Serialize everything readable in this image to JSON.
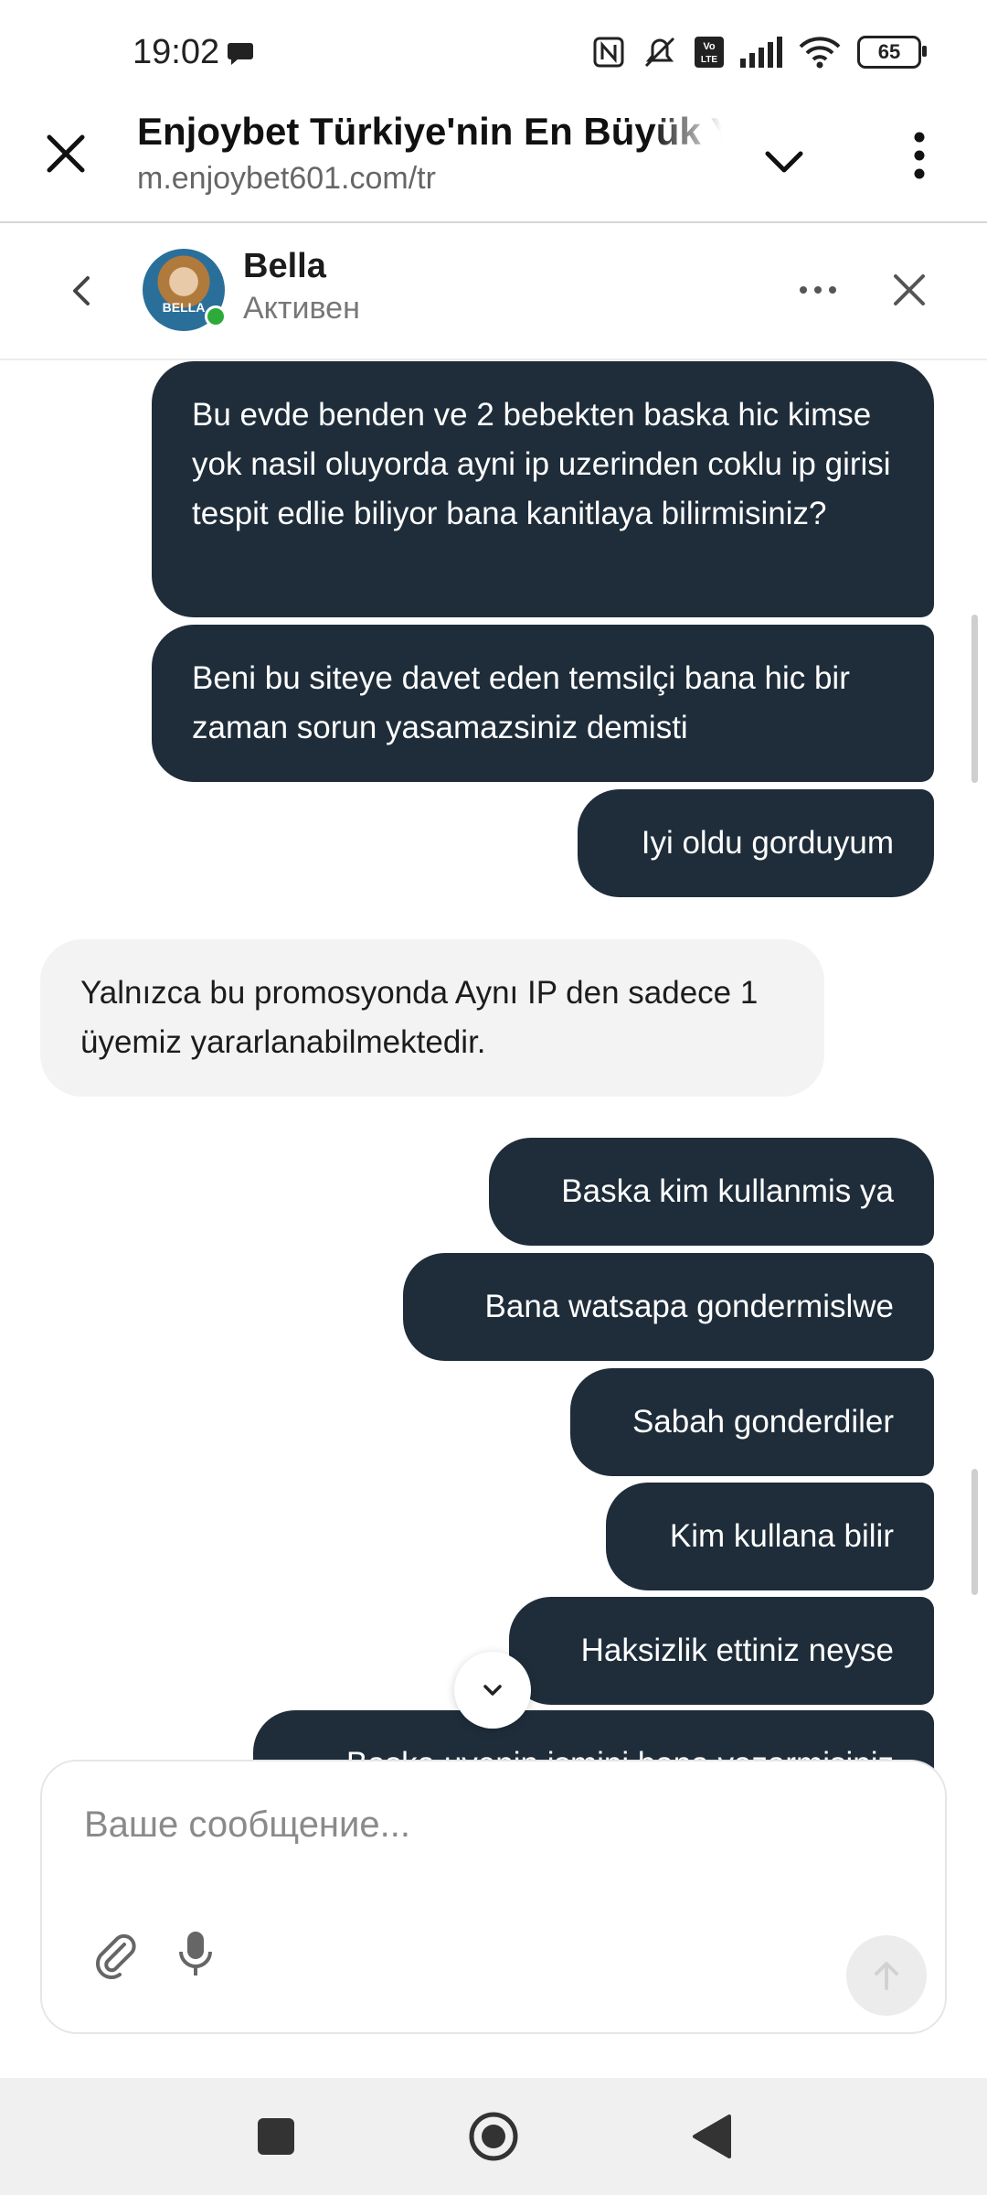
{
  "status_bar": {
    "time": "19:02",
    "battery": "65",
    "icons": [
      "message-icon",
      "nfc-icon",
      "mute-icon",
      "volte-icon",
      "signal-icon",
      "wifi-icon",
      "battery-icon"
    ]
  },
  "browser": {
    "title": "Enjoybet Türkiye'nin En Büyük Ya",
    "url": "m.enjoybet601.com/tr"
  },
  "chat": {
    "agent_name": "Bella",
    "agent_status": "Активен",
    "avatar_label": "BELLA"
  },
  "messages": [
    {
      "side": "out",
      "text": "Bu evde benden ve 2 bebekten baska hic kimse yok nasil oluyorda ayni ip uzerinden coklu ip girisi tespit edlie biliyor bana kanitlaya bilirmisiniz?"
    },
    {
      "side": "out",
      "text": "Beni bu siteye davet eden temsilçi bana hic bir zaman sorun yasamazsiniz demisti"
    },
    {
      "side": "out",
      "text": "Iyi oldu gorduyum"
    },
    {
      "side": "in",
      "text": "Yalnızca bu promosyonda Aynı IP den sadece 1 üyemiz yararlanabilmektedir."
    },
    {
      "side": "out",
      "text": "Baska kim kullanmis ya"
    },
    {
      "side": "out",
      "text": "Bana watsapa gondermislwe"
    },
    {
      "side": "out",
      "text": "Sabah gonderdiler"
    },
    {
      "side": "out",
      "text": "Kim kullana bilir"
    },
    {
      "side": "out",
      "text": "Haksizlik ettiniz neyse"
    },
    {
      "side": "out",
      "text": "Baska uyenin ismini bana yazarmisiniz"
    }
  ],
  "composer": {
    "placeholder": "Ваше сообщение..."
  },
  "colors": {
    "outgoing_bubble": "#1f2d3a",
    "incoming_bubble": "#f3f3f3",
    "online": "#2eaa3a"
  }
}
